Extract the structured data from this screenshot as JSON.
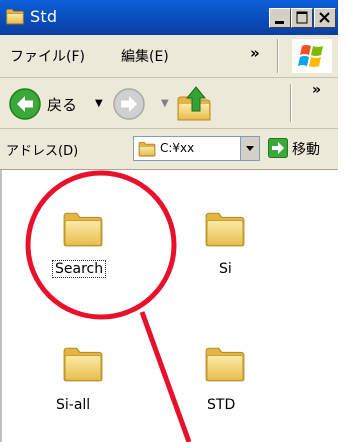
{
  "window": {
    "title": "Std",
    "folder_icon": "folder-icon"
  },
  "title_buttons": {
    "minimize": "minimize-icon",
    "maximize": "maximize-icon",
    "close": "close-icon"
  },
  "menu": {
    "items": [
      "ファイル(F)",
      "編集(E)"
    ],
    "overflow": "»",
    "logo": "windows-logo"
  },
  "toolbar": {
    "back_label": "戻る",
    "dropdown_glyph": "▼",
    "overflow": "»"
  },
  "address": {
    "label": "アドレス(D)",
    "path": "C:¥xx",
    "go_label": "移動"
  },
  "files": [
    {
      "name": "Search",
      "icon": "folder-icon",
      "focused": true
    },
    {
      "name": "Si",
      "icon": "folder-icon",
      "focused": false
    },
    {
      "name": "Si-all",
      "icon": "folder-icon",
      "focused": false
    },
    {
      "name": "STD",
      "icon": "folder-icon",
      "focused": false
    }
  ],
  "colors": {
    "titlebar": "#0a4bb8",
    "chrome": "#ece9d8",
    "annotation": "#e8102a",
    "folder": "#f5d67a"
  }
}
